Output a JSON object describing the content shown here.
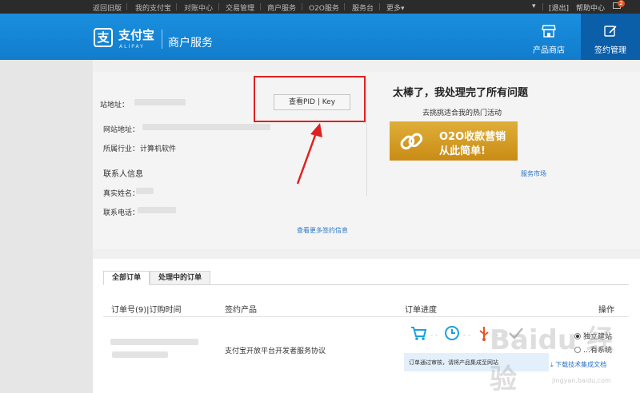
{
  "topnav": {
    "links": [
      "返回旧版",
      "我的支付宝",
      "对账中心",
      "交易管理",
      "商户服务",
      "O2O服务",
      "服务台",
      "更多"
    ],
    "more_arrow": "caret-down-icon",
    "logout": "[退出]",
    "help": "帮助中心",
    "mail_icon": "mail-icon",
    "mail_count": "2"
  },
  "header": {
    "logo_mark": "支",
    "logo_text": "支付宝",
    "logo_sub": "ALIPAY",
    "service": "商户服务",
    "shop": {
      "label": "产品商店",
      "icon": "shop-icon"
    },
    "sign": {
      "label": "签约管理",
      "icon": "edit-icon"
    }
  },
  "info": {
    "site_addr_label": "站地址：",
    "website_label": "网站地址：",
    "industry_label": "所属行业：",
    "industry_value": "计算机软件",
    "contact_title": "联系人信息",
    "real_name_label": "真实姓名：",
    "phone_label": "联系电话：",
    "more_link": "查看更多签约信息",
    "pid_button": "查看PID | Key"
  },
  "promo": {
    "title": "太棒了，我处理完了所有问题",
    "subtitle": "去挑挑适合我的热门活动",
    "banner_line1": "O2O收款营销",
    "banner_line2": "从此简单!",
    "market_link": "服务市场"
  },
  "orders": {
    "tabs": [
      "全部订单",
      "处理中的订单"
    ],
    "columns": {
      "order": "订单号(9)|订购时间",
      "product": "签约产品",
      "progress": "订单进度",
      "action": "操作"
    },
    "rows": [
      {
        "product": "支付宝开放平台开发者服务协议",
        "progress_note": "订单通过审核，请将产品集成至网站",
        "options": [
          "独立建站",
          "…有系统"
        ],
        "download": "下载技术集成文档"
      }
    ]
  },
  "watermark": "Baidu 经验",
  "watermark_sub": "jingyan.baidu.com"
}
